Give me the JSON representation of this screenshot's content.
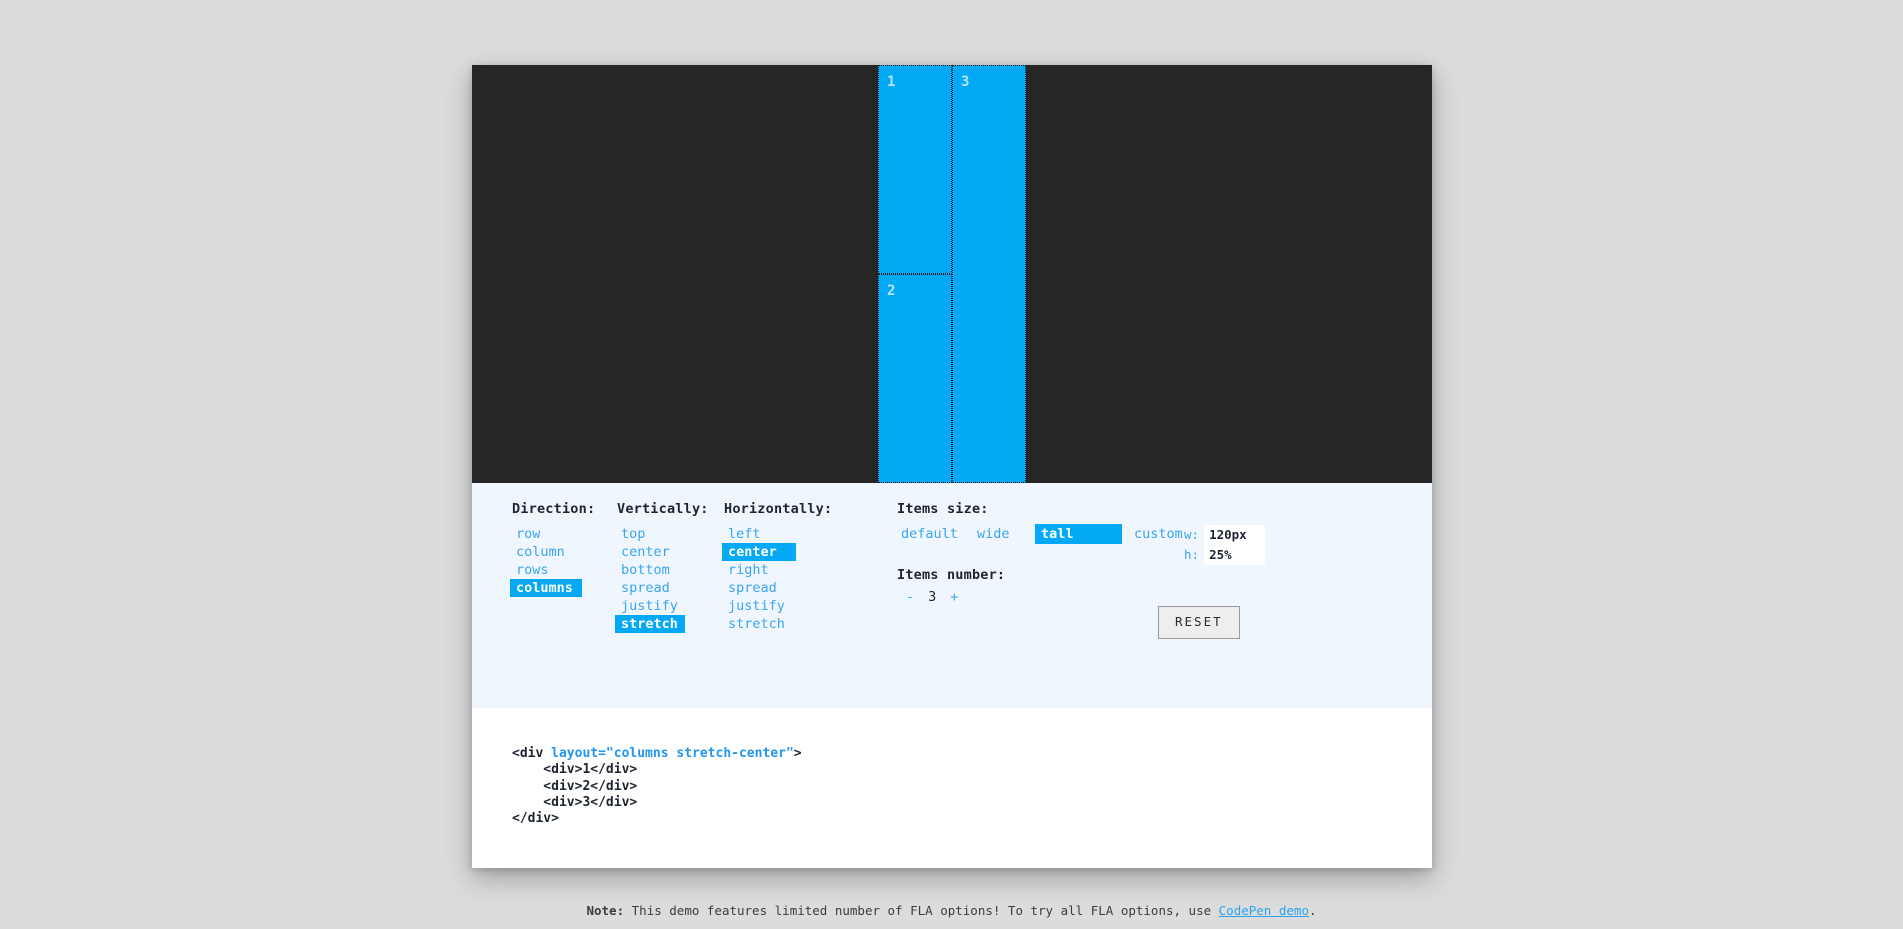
{
  "preview": {
    "items": [
      {
        "label": "1"
      },
      {
        "label": "2"
      },
      {
        "label": "3"
      }
    ],
    "item_color": "#03a9f4",
    "stage_color": "#262626"
  },
  "controls": {
    "direction": {
      "heading": "Direction:",
      "options": [
        "row",
        "column",
        "rows",
        "columns"
      ],
      "selected": "columns"
    },
    "vertically": {
      "heading": "Vertically:",
      "options": [
        "top",
        "center",
        "bottom",
        "spread",
        "justify",
        "stretch"
      ],
      "selected": "stretch"
    },
    "horizontally": {
      "heading": "Horizontally:",
      "options": [
        "left",
        "center",
        "right",
        "spread",
        "justify",
        "stretch"
      ],
      "selected": "center"
    },
    "items_size": {
      "heading": "Items size:",
      "options": [
        "default",
        "wide",
        "tall",
        "custom"
      ],
      "selected": "tall",
      "width_label": "w:",
      "width_value": "120px",
      "height_label": "h:",
      "height_value": "25%"
    },
    "items_number": {
      "heading": "Items number:",
      "decrement": "-",
      "value": "3",
      "increment": "+"
    },
    "reset_label": "RESET",
    "accent_color": "#03a9f4"
  },
  "code": {
    "line1_open": "<div ",
    "line1_attr": "layout=\"columns stretch-center\"",
    "line1_close": ">",
    "line2": "    <div>1</div>",
    "line3": "    <div>2</div>",
    "line4": "    <div>3</div>",
    "line5": "</div>"
  },
  "footer": {
    "note_label": "Note:",
    "note_text": " This demo features limited number of FLA options! To try all FLA options, use ",
    "link_text": "CodePen demo",
    "period": "."
  }
}
